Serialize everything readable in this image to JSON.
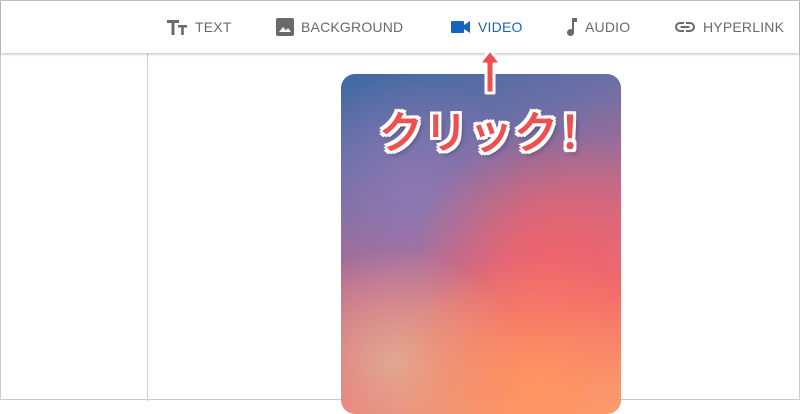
{
  "toolbar": {
    "items": [
      {
        "label": "TEXT",
        "icon": "text-size-icon",
        "active": false
      },
      {
        "label": "BACKGROUND",
        "icon": "image-icon",
        "active": false
      },
      {
        "label": "VIDEO",
        "icon": "videocam-icon",
        "active": true
      },
      {
        "label": "AUDIO",
        "icon": "music-note-icon",
        "active": false
      },
      {
        "label": "HYPERLINK",
        "icon": "link-icon",
        "active": false
      }
    ],
    "active_color": "#1565c0",
    "inactive_color": "#6a6a6a"
  },
  "annotation": {
    "callout_text": "クリック！",
    "callout_color": "#ef4f4f",
    "arrow_icon": "up-arrow-icon"
  },
  "canvas": {
    "preview": "gradient-background-card"
  }
}
